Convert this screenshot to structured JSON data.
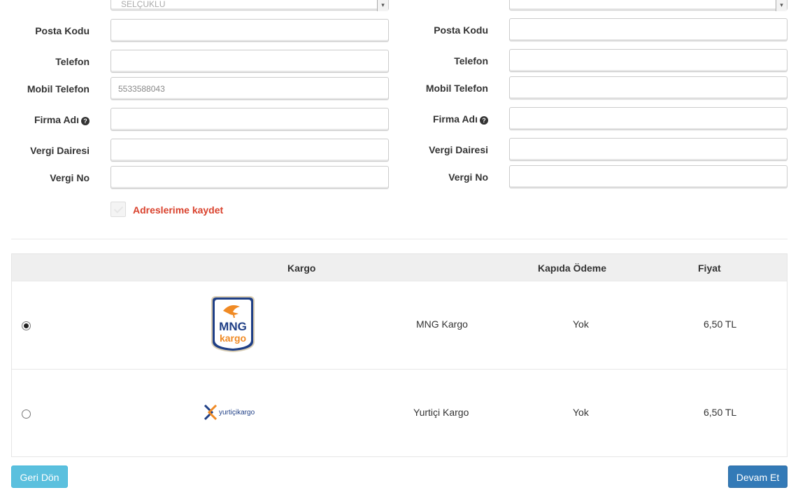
{
  "left_form": {
    "district_value": "SELÇUKLU",
    "postal_code_label": "Posta Kodu",
    "phone_label": "Telefon",
    "mobile_label": "Mobil Telefon",
    "mobile_value": "5533588043",
    "company_label": "Firma Adı",
    "tax_office_label": "Vergi Dairesi",
    "tax_no_label": "Vergi No",
    "save_address_label": "Adreslerime kaydet"
  },
  "right_form": {
    "postal_code_label": "Posta Kodu",
    "phone_label": "Telefon",
    "mobile_label": "Mobil Telefon",
    "company_label": "Firma Adı",
    "tax_office_label": "Vergi Dairesi",
    "tax_no_label": "Vergi No"
  },
  "shipping_table": {
    "headers": {
      "cargo": "Kargo",
      "cod": "Kapıda Ödeme",
      "price": "Fiyat"
    },
    "rows": [
      {
        "selected": true,
        "logo": "mng-kargo-logo",
        "logo_text_top": "MNG",
        "logo_text_bottom": "kargo",
        "name": "MNG Kargo",
        "cod": "Yok",
        "price": "6,50 TL"
      },
      {
        "selected": false,
        "logo": "yurtici-kargo-logo",
        "logo_text": "yurtiçikargo",
        "name": "Yurtiçi Kargo",
        "cod": "Yok",
        "price": "6,50 TL"
      }
    ]
  },
  "buttons": {
    "back": "Geri Dön",
    "next": "Devam Et"
  },
  "colors": {
    "save_label": "#d9412c",
    "back_button": "#5bc0de",
    "next_button": "#337ab7",
    "header_bg": "#efefef"
  }
}
